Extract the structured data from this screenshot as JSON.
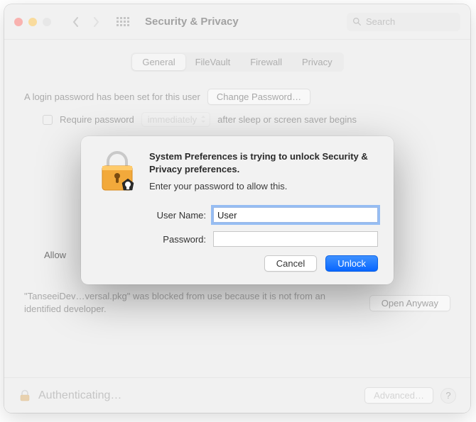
{
  "window": {
    "title": "Security & Privacy",
    "search_placeholder": "Search"
  },
  "tabs": {
    "items": [
      "General",
      "FileVault",
      "Firewall",
      "Privacy"
    ],
    "active_index": 0
  },
  "general": {
    "login_text": "A login password has been set for this user",
    "change_pwd_btn": "Change Password…",
    "require_pwd_label": "Require password",
    "require_delay": "immediately",
    "require_after": "after sleep or screen saver begins",
    "allow_label": "Allow",
    "blocked_text": "\"TanseeiDev…versal.pkg\" was blocked from use because it is not from an identified developer.",
    "open_anyway_btn": "Open Anyway"
  },
  "footer": {
    "status": "Authenticating…",
    "advanced_btn": "Advanced…"
  },
  "dialog": {
    "title": "System Preferences is trying to unlock Security & Privacy preferences.",
    "subtitle": "Enter your password to allow this.",
    "username_label": "User Name:",
    "username_value": "User",
    "password_label": "Password:",
    "password_value": "",
    "cancel_btn": "Cancel",
    "unlock_btn": "Unlock"
  }
}
